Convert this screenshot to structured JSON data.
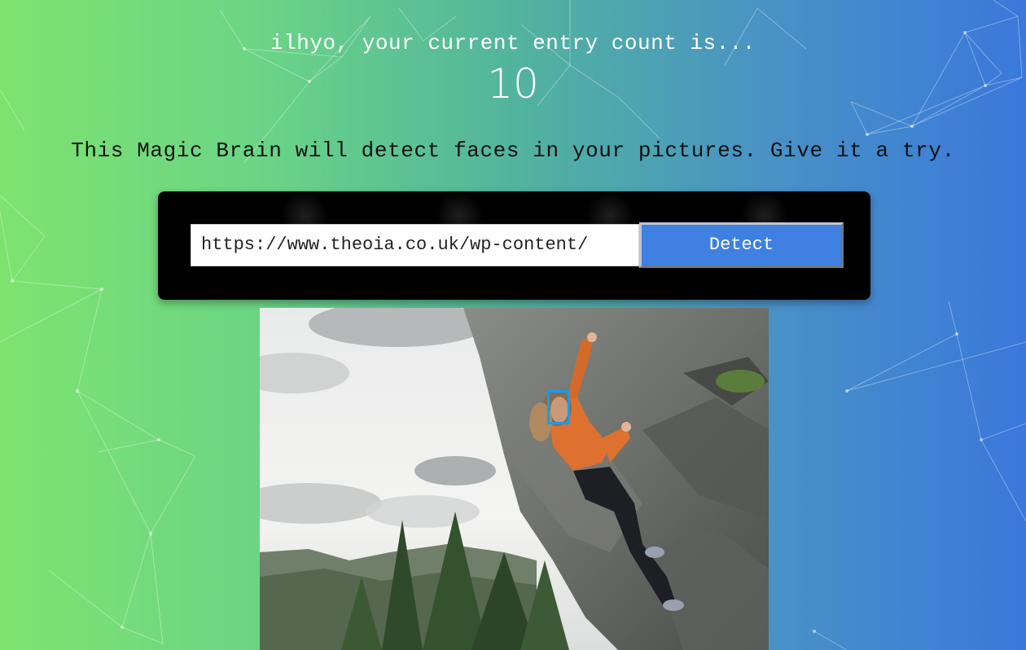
{
  "header": {
    "greeting": "ilhyo, your current entry count is...",
    "entry_count": "10"
  },
  "tagline": "This Magic Brain will detect faces in your pictures. Give it a try.",
  "form": {
    "url_value": "https://www.theoia.co.uk/wp-content/",
    "detect_label": "Detect"
  },
  "image": {
    "description_icon": "climber-photo",
    "detected_faces": 1
  },
  "colors": {
    "gradient_start": "#7ee36f",
    "gradient_end": "#3a78db",
    "button": "#3f80e0",
    "face_box": "#149df2"
  }
}
